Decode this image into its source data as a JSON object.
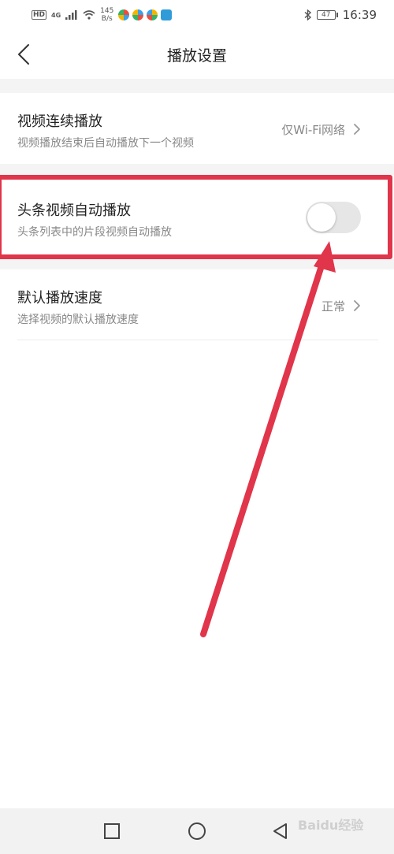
{
  "status_bar": {
    "hd": "HD",
    "network": "4G",
    "speed_value": "145",
    "speed_unit": "B/s",
    "battery": "47",
    "time": "16:39",
    "app_icon_colors": [
      "#e94e3c",
      "#3aa0e8",
      "#f5b400",
      "#2f9bd8"
    ]
  },
  "header": {
    "title": "播放设置",
    "back_icon": "chevron-left-icon"
  },
  "settings": [
    {
      "title": "视频连续播放",
      "subtitle": "视频播放结束后自动播放下一个视频",
      "value": "仅Wi-Fi网络",
      "control": "chevron-right-icon"
    },
    {
      "title": "头条视频自动播放",
      "subtitle": "头条列表中的片段视频自动播放",
      "toggle_on": false,
      "control": "toggle-switch"
    },
    {
      "title": "默认播放速度",
      "subtitle": "选择视频的默认播放速度",
      "value": "正常",
      "control": "chevron-right-icon"
    }
  ],
  "annotation": {
    "color": "#e0354a"
  },
  "nav_bar": {
    "icons": [
      "square-icon",
      "circle-icon",
      "triangle-back-icon"
    ]
  },
  "watermark": "Baidu经验"
}
